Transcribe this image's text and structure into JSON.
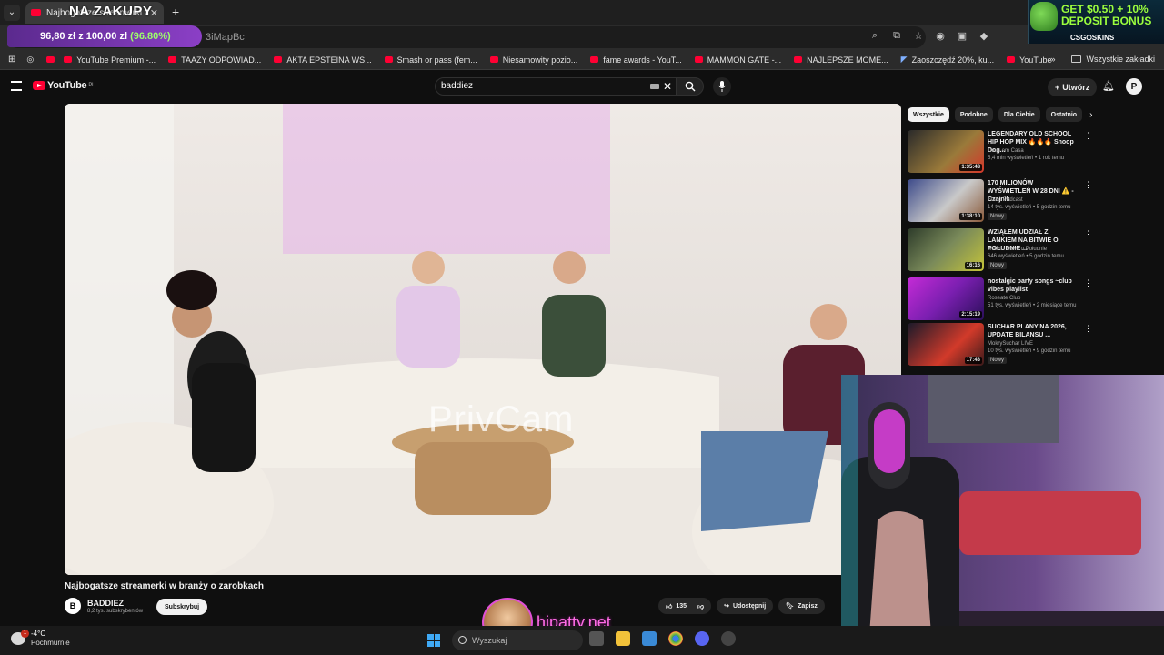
{
  "browser": {
    "tab_title": "Najbogatsze streamerki w branży o zarobkach",
    "overlay_banner": "NA ZAKUPY",
    "url_fragment": "3iMapBc",
    "price_pill": {
      "amount": "96,80 zł z 100,00 zł",
      "percent": "(96.80%)"
    },
    "promo": {
      "line1": "GET $0.50 + 10%",
      "line2": "DEPOSIT BONUS",
      "brand": "CSG⭘SKINS"
    },
    "bookmarks": [
      "YouTube Premium -...",
      "TAAZY ODPOWIAD...",
      "AKTA EPSTEINA WS...",
      "Smash or pass (fem...",
      "Niesamowity pozio...",
      "fame awards - YouT...",
      "MAMMON GATE -...",
      "NAJLEPSZE MOME...",
      "Zaoszczędź 20%, ku...",
      "YouTube"
    ],
    "all_bookmarks": "Wszystkie zakładki"
  },
  "youtube": {
    "logo": "YouTube",
    "logo_region": "PL",
    "search_value": "baddiez",
    "create_label": "Utwórz",
    "video": {
      "watermark": "PrivCam",
      "title": "Najbogatsze streamerki w branży o zarobkach",
      "channel": "BADDIEZ",
      "subscribers": "8,2 tys. subskrybentów",
      "subscribe_label": "Subskrybuj",
      "likes": "135",
      "share_label": "Udostępnij",
      "save_label": "Zapisz"
    },
    "chips": [
      "Wszystkie",
      "Podobne",
      "Dla Ciebie",
      "Ostatnio"
    ],
    "recommendations": [
      {
        "title": "LEGENDARY OLD SCHOOL HIP HOP MIX 🔥🔥🔥 Snoop Dog...",
        "channel": "Deus em Casa",
        "meta": "5,4 mln wyświetleń • 1 rok temu",
        "duration": "1:35:48",
        "badge": ""
      },
      {
        "title": "170 MILIONÓW WYŚWIETLEŃ W 28 DNI ⚠️ - Czajnik",
        "channel": "Fomo Podcast",
        "meta": "14 tys. wyświetleń • 5 godzin temu",
        "duration": "1:38:10",
        "badge": "Nowy"
      },
      {
        "title": "WZIĄŁEM UDZIAŁ Z LANKIEM NA BITWIE O POŁUDNIE ...",
        "channel": "wolan i Bitwa o Południe",
        "meta": "646 wyświetleń • 5 godzin temu",
        "duration": "16:16",
        "badge": "Nowy"
      },
      {
        "title": "nostalgic party songs ~club vibes playlist",
        "channel": "Roseate Club",
        "meta": "51 tys. wyświetleń • 2 miesiące temu",
        "duration": "2:15:19",
        "badge": ""
      },
      {
        "title": "SUCHAR PLANY NA 2026, UPDATE BILANSU ...",
        "channel": "MokrySuchar LIVE",
        "meta": "10 tys. wyświetleń • 9 godzin temu",
        "duration": "17:43",
        "badge": "Nowy"
      }
    ]
  },
  "overlay": {
    "site": "hipatty.net"
  },
  "taskbar": {
    "temp": "-4°C",
    "weather": "Pochmurnie",
    "search_placeholder": "Wyszukaj"
  }
}
